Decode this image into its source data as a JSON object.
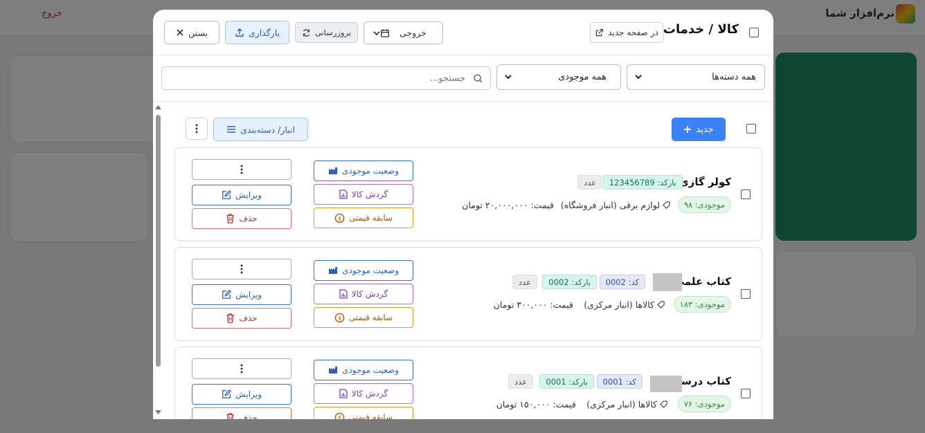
{
  "background": {
    "brand": "نرم‌افزار شما",
    "exit_label": "خروج"
  },
  "modal": {
    "title": "کالا / خدمات",
    "open_new_page": "در صفحه جدید",
    "export_label": "خروجی",
    "refresh_label": "بروزرسانی",
    "upload_label": "بارگذاری",
    "close_label": "بستن"
  },
  "filters": {
    "category_selected": "همه دسته‌ها",
    "stock_selected": "همه موجودی",
    "search_placeholder": "جستجو..."
  },
  "toolbar": {
    "new_label": "جدید",
    "group_label": "انبار/ دسته‌بندی"
  },
  "actions": {
    "stock_status": "وضعیت موجودی",
    "turnover": "گردش کالا",
    "price_history": "سابقه قیمتی",
    "edit": "ویرایش",
    "delete": "حذف"
  },
  "items": [
    {
      "name": "کولر گازی",
      "barcode": "بارکد: 123456789",
      "code": "",
      "unit": "عدد",
      "stock": "موجودی: ۹۸",
      "category": "لوازم برقی (انبار فروشگاه)",
      "price": "قیمت: ۲۰,۰۰۰,۰۰۰ تومان"
    },
    {
      "name": "کتاب علمی",
      "barcode": "بارکد: 0002",
      "code": "کد: 0002",
      "unit": "عدد",
      "stock": "موجودی: ۱۸۳",
      "category": "کالاها (انبار مرکزی)",
      "price": "قیمت: ۳۰۰,۰۰۰ تومان"
    },
    {
      "name": "کتاب درسی",
      "barcode": "بارکد: 0001",
      "code": "کد: 0001",
      "unit": "عدد",
      "stock": "موجودی: ۷۶",
      "category": "کالاها (انبار مرکزی)",
      "price": "قیمت: ۱۵۰,۰۰۰ تومان"
    }
  ]
}
